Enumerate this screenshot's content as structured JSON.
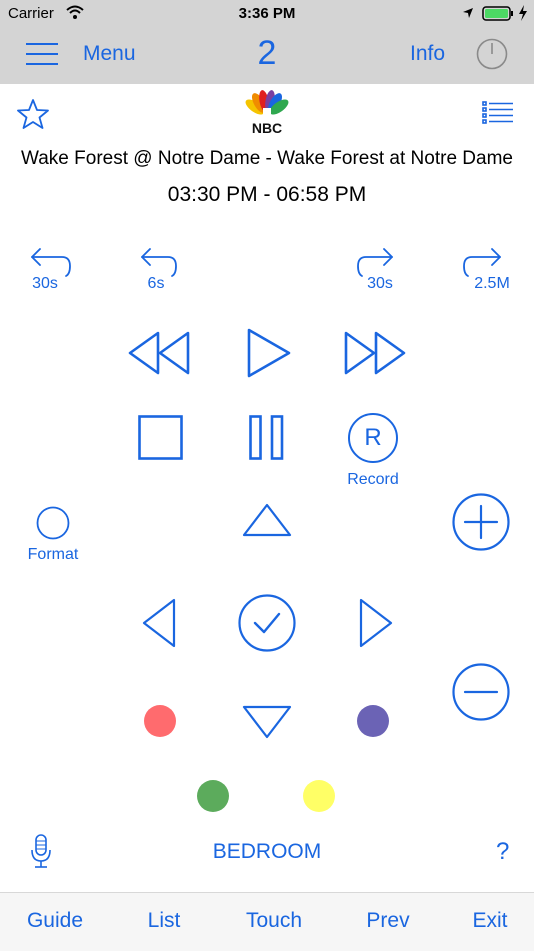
{
  "status_bar": {
    "carrier": "Carrier",
    "time": "3:36 PM",
    "battery_color": "#4cd964"
  },
  "top_nav": {
    "menu_label": "Menu",
    "channel_number": "2",
    "info_label": "Info",
    "icons": [
      "hamburger-icon",
      "power-icon"
    ]
  },
  "program": {
    "network_logo": "NBC",
    "title": "Wake Forest @ Notre Dame - Wake Forest at Notre Dame",
    "time_range": "03:30 PM - 06:58 PM",
    "icons": [
      "star-icon",
      "list-icon"
    ]
  },
  "skip_buttons": {
    "back_30": "30s",
    "back_6": "6s",
    "forward_30": "30s",
    "forward_2_5m": "2.5M"
  },
  "record": {
    "letter": "R",
    "label": "Record"
  },
  "format": {
    "label": "Format"
  },
  "color_buttons": {
    "red": "#ff6b6e",
    "purple": "#6b63b5",
    "green": "#5cab5c",
    "yellow": "#ffff66"
  },
  "room": {
    "label": "BEDROOM",
    "help": "?"
  },
  "bottom_tabs": {
    "guide": "Guide",
    "list": "List",
    "touch": "Touch",
    "prev": "Prev",
    "exit": "Exit"
  },
  "accent_color": "#1a66e0"
}
